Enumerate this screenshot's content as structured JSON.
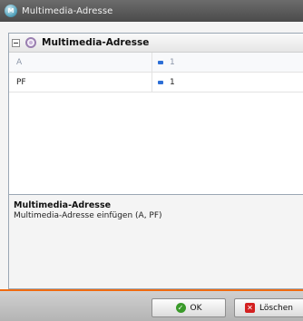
{
  "window": {
    "title": "Multimedia-Adresse"
  },
  "grid": {
    "category": "Multimedia-Adresse",
    "rows": [
      {
        "name": "A",
        "value": "1",
        "enabled": false
      },
      {
        "name": "PF",
        "value": "1",
        "enabled": true
      }
    ]
  },
  "description": {
    "title": "Multimedia-Adresse",
    "text": "Multimedia-Adresse einfügen (A, PF)"
  },
  "buttons": {
    "ok_label": "OK",
    "delete_label": "Löschen"
  },
  "colors": {
    "accent": "#f06a10",
    "ok_icon": "#3a9a2a",
    "delete_icon": "#d32020",
    "value_icon": "#2d6fd6"
  },
  "icons": {
    "app": "multimedia-app-icon",
    "category": "category-icon",
    "value": "value-icon",
    "ok": "checkmark-icon",
    "delete": "delete-icon"
  }
}
